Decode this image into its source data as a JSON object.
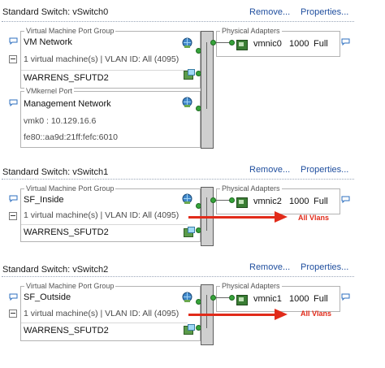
{
  "switches": [
    {
      "title": "Standard Switch: vSwitch0",
      "remove": "Remove...",
      "properties": "Properties...",
      "port_groups": [
        {
          "kind": "Virtual Machine Port Group",
          "name": "VM Network",
          "info": "1 virtual machine(s) | VLAN ID: All (4095)",
          "vm": "WARRENS_SFUTD2"
        },
        {
          "kind": "VMkernel Port",
          "name": "Management Network",
          "line1": "vmk0 : 10.129.16.6",
          "line2": "fe80::aa9d:21ff:fefc:6010"
        }
      ],
      "adapters_title": "Physical Adapters",
      "adapter": {
        "name": "vmnic0",
        "speed": "1000",
        "duplex": "Full"
      }
    },
    {
      "title": "Standard Switch: vSwitch1",
      "remove": "Remove...",
      "properties": "Properties...",
      "port_groups": [
        {
          "kind": "Virtual Machine Port Group",
          "name": "SF_Inside",
          "info": "1 virtual machine(s) | VLAN ID: All (4095)",
          "vm": "WARRENS_SFUTD2"
        }
      ],
      "adapters_title": "Physical Adapters",
      "adapter": {
        "name": "vmnic2",
        "speed": "1000",
        "duplex": "Full"
      },
      "annotation": "All Vlans"
    },
    {
      "title": "Standard Switch: vSwitch2",
      "remove": "Remove...",
      "properties": "Properties...",
      "port_groups": [
        {
          "kind": "Virtual Machine Port Group",
          "name": "SF_Outside",
          "info": "1 virtual machine(s) | VLAN ID: All (4095)",
          "vm": "WARRENS_SFUTD2"
        }
      ],
      "adapters_title": "Physical Adapters",
      "adapter": {
        "name": "vmnic1",
        "speed": "1000",
        "duplex": "Full"
      },
      "annotation": "All Vlans"
    }
  ],
  "icons": {
    "bubble": "speech-bubble-icon",
    "globe": "network-globe-icon",
    "vm": "virtual-machine-icon",
    "nic": "network-adapter-icon",
    "collapse": "collapse-minus-icon"
  },
  "colors": {
    "link": "#1f4e9e",
    "annotation": "#e12b1a",
    "dot": "#36a33a"
  }
}
